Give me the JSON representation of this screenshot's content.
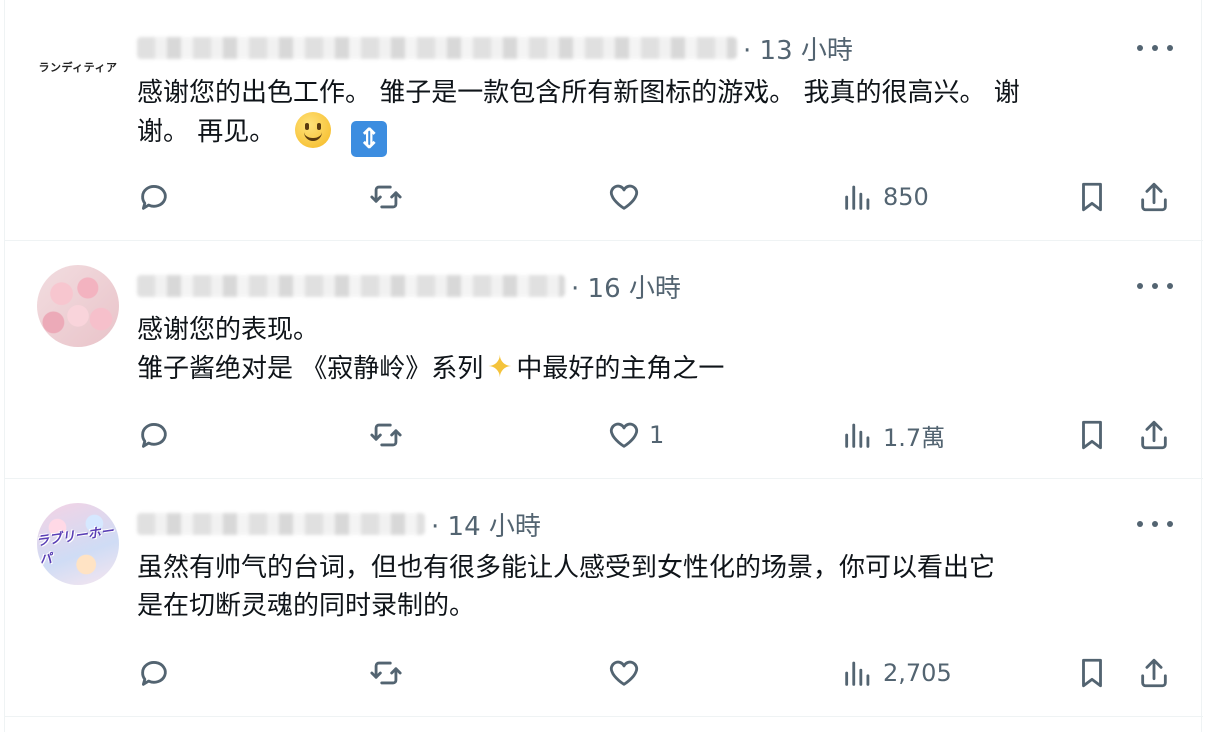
{
  "posts": [
    {
      "avatar_text": "ランディティア",
      "timestamp": "· 13 小時",
      "text_line1": "感谢您的出色工作。 雏子是一款包含所有新图标的游戏。 我真的很高兴。 谢",
      "text_line2": "谢。 再见。",
      "emojis": [
        "slightly-smiling-face",
        "up-down-arrow"
      ],
      "likes": "",
      "views": "850"
    },
    {
      "avatar_text": "",
      "timestamp": "· 16 小時",
      "text_line1": "感谢您的表现。",
      "text_line2_a": "雏子酱绝对是 《寂静岭》系列",
      "text_line2_b": "中最好的主角之一",
      "emojis": [
        "sparkles"
      ],
      "likes": "1",
      "views": "1.7萬"
    },
    {
      "avatar_text": "ラブリーホーパ",
      "timestamp": "· 14 小時",
      "text_line1": "虽然有帅气的台词，但也有很多能让人感受到女性化的场景，你可以看出它",
      "text_line2": "是在切断灵魂的同时录制的。",
      "likes": "",
      "views": "2,705"
    }
  ],
  "colors": {
    "text": "#0f1419",
    "muted": "#536471",
    "divider": "#eff3f4"
  }
}
